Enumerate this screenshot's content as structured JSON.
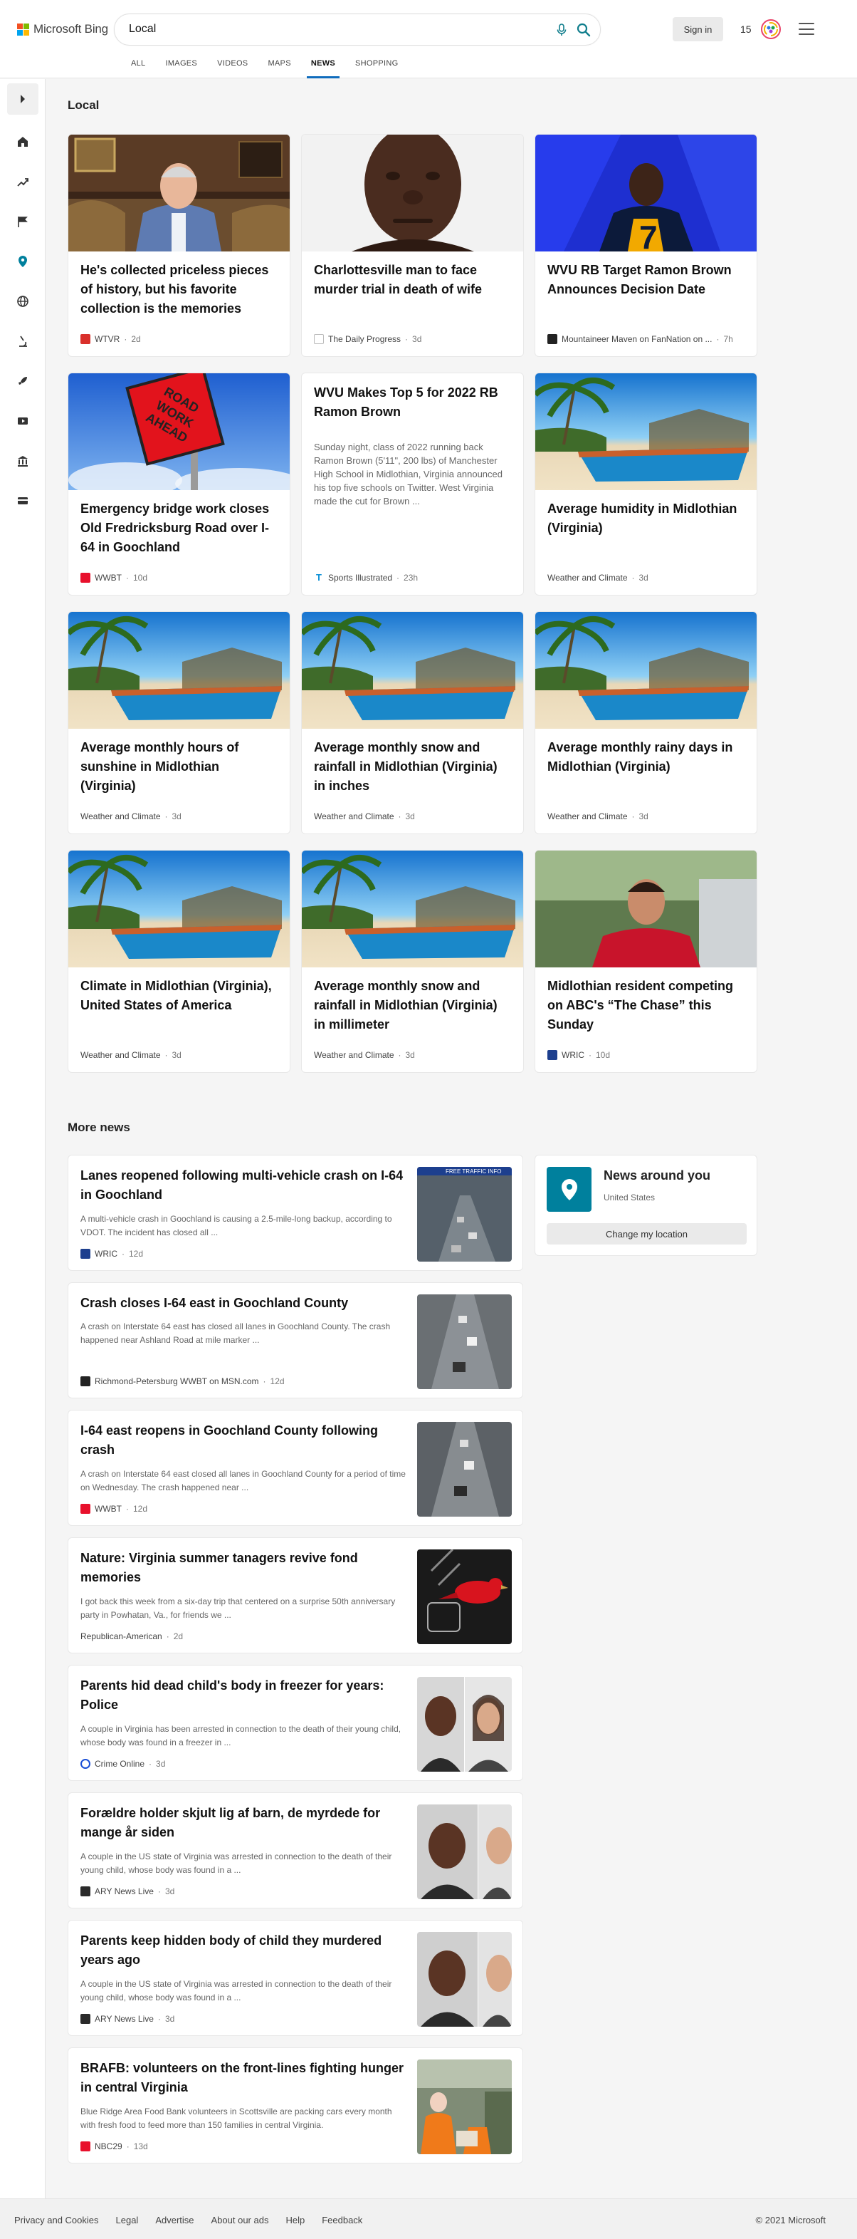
{
  "header": {
    "logo_text": "Microsoft Bing",
    "search_value": "Local",
    "sign_in": "Sign in",
    "points": "15",
    "tabs": [
      {
        "label": "ALL"
      },
      {
        "label": "IMAGES"
      },
      {
        "label": "VIDEOS"
      },
      {
        "label": "MAPS"
      },
      {
        "label": "NEWS"
      },
      {
        "label": "SHOPPING"
      }
    ],
    "active_tab": "NEWS",
    "accent_color": "#0f6cbd"
  },
  "rail": {
    "icons": [
      "chevron-right-icon",
      "home-icon",
      "trending-icon",
      "flag-icon",
      "location-pin-icon",
      "globe-icon",
      "microscope-icon",
      "rocket-icon",
      "video-icon",
      "bank-icon",
      "card-icon"
    ]
  },
  "local": {
    "heading": "Local",
    "cards": [
      {
        "title": "He's collected priceless pieces of history, but his favorite collection is the memories",
        "source": "WTVR",
        "age": "2d"
      },
      {
        "title": "Charlottesville man to face murder trial in death of wife",
        "source": "The Daily Progress",
        "age": "3d"
      },
      {
        "title": "WVU RB Target Ramon Brown Announces Decision Date",
        "source": "Mountaineer Maven on FanNation on ...",
        "age": "7h"
      },
      {
        "title": "Emergency bridge work closes Old Fredricksburg Road over I-64 in Goochland",
        "source": "WWBT",
        "age": "10d",
        "sign_text": "ROAD WORK AHEAD"
      },
      {
        "title": "WVU Makes Top 5 for 2022 RB Ramon Brown",
        "snippet": "Sunday night, class of 2022 running back Ramon Brown (5'11\", 200 lbs) of Manchester High School in Midlothian, Virginia announced his top five schools on Twitter. West Virginia made the cut for Brown ...",
        "source": "Sports Illustrated",
        "age": "23h"
      },
      {
        "title": "Average humidity in Midlothian (Virginia)",
        "source": "Weather and Climate",
        "age": "3d"
      },
      {
        "title": "Average monthly hours of sunshine in Midlothian (Virginia)",
        "source": "Weather and Climate",
        "age": "3d"
      },
      {
        "title": "Average monthly snow and rainfall in Midlothian (Virginia) in inches",
        "source": "Weather and Climate",
        "age": "3d"
      },
      {
        "title": "Average monthly rainy days in Midlothian (Virginia)",
        "source": "Weather and Climate",
        "age": "3d"
      },
      {
        "title": "Climate in Midlothian (Virginia), United States of America",
        "source": "Weather and Climate",
        "age": "3d"
      },
      {
        "title": "Average monthly snow and rainfall in Midlothian (Virginia) in millimeter",
        "source": "Weather and Climate",
        "age": "3d"
      },
      {
        "title": "Midlothian resident competing on ABC's “The Chase” this Sunday",
        "source": "WRIC",
        "age": "10d"
      }
    ]
  },
  "more_news": {
    "heading": "More news",
    "items": [
      {
        "title": "Lanes reopened following multi-vehicle crash on I-64 in Goochland",
        "snippet": "A multi-vehicle crash in Goochland is causing a 2.5-mile-long backup, according to VDOT. The incident has closed all ...",
        "source": "WRIC",
        "age": "12d",
        "thumb_text": "FREE TRAFFIC INFO"
      },
      {
        "title": "Crash closes I-64 east in Goochland County",
        "snippet": "A crash on Interstate 64 east has closed all lanes in Goochland County. The crash happened near Ashland Road at mile marker ...",
        "source": "Richmond-Petersburg WWBT on MSN.com",
        "age": "12d"
      },
      {
        "title": "I-64 east reopens in Goochland County following crash",
        "snippet": "A crash on Interstate 64 east closed all lanes in Goochland County for a period of time on Wednesday. The crash happened near ...",
        "source": "WWBT",
        "age": "12d"
      },
      {
        "title": "Nature: Virginia summer tanagers revive fond memories",
        "snippet": "I got back this week from a six-day trip that centered on a surprise 50th anniversary party in Powhatan, Va., for friends we ...",
        "source": "Republican-American",
        "age": "2d"
      },
      {
        "title": "Parents hid dead child's body in freezer for years: Police",
        "snippet": "A couple in Virginia has been arrested in connection to the death of their young child, whose body was found in a freezer in ...",
        "source": "Crime Online",
        "age": "3d"
      },
      {
        "title": "Forældre holder skjult lig af barn, de myrdede for mange år siden",
        "snippet": "A couple in the US state of Virginia was arrested in connection to the death of their young child, whose body was found in a ...",
        "source": "ARY News Live",
        "age": "3d"
      },
      {
        "title": "Parents keep hidden body of child they murdered years ago",
        "snippet": "A couple in the US state of Virginia was arrested in connection to the death of their young child, whose body was found in a ...",
        "source": "ARY News Live",
        "age": "3d"
      },
      {
        "title": "BRAFB: volunteers on the front-lines fighting hunger in central Virginia",
        "snippet": "Blue Ridge Area Food Bank volunteers in Scottsville are packing cars every month with fresh food to feed more than 150 families in central Virginia.",
        "source": "NBC29",
        "age": "13d"
      }
    ]
  },
  "around": {
    "title": "News around you",
    "location": "United States",
    "button": "Change my location"
  },
  "footer": {
    "links": [
      "Privacy and Cookies",
      "Legal",
      "Advertise",
      "About our ads",
      "Help",
      "Feedback"
    ],
    "copyright": "© 2021 Microsoft"
  }
}
